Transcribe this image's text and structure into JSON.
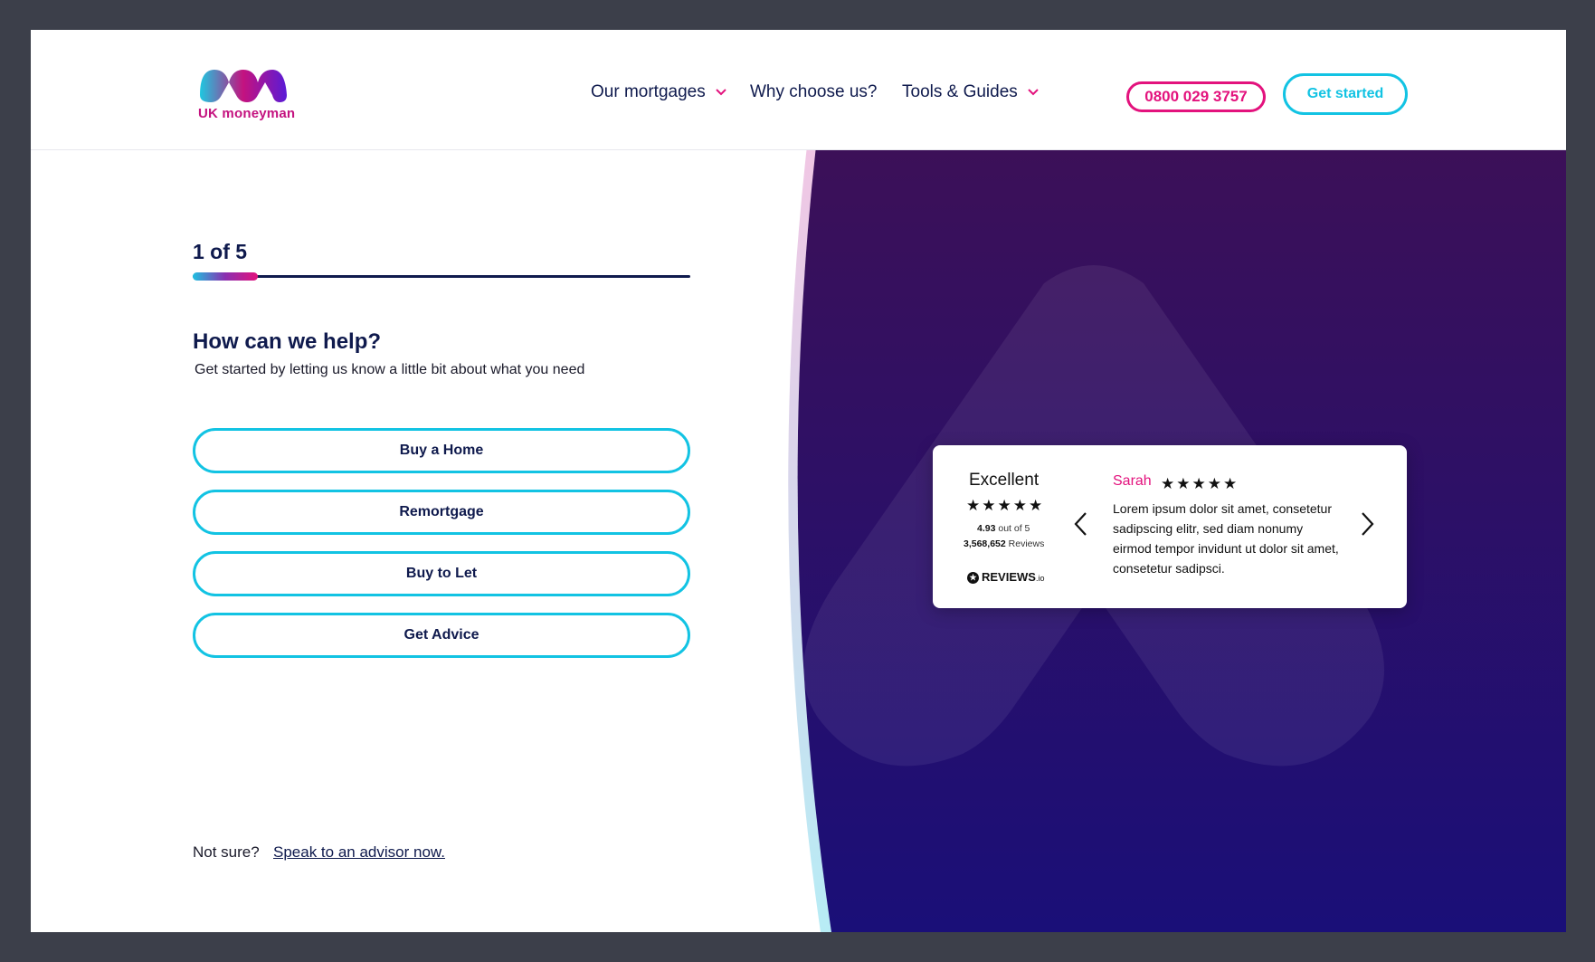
{
  "header": {
    "logo_text": "UK moneyman",
    "nav": [
      {
        "label": "Our mortgages",
        "has_dropdown": true
      },
      {
        "label": "Why choose us?",
        "has_dropdown": false
      },
      {
        "label": "Tools & Guides",
        "has_dropdown": true
      }
    ],
    "phone_label": "0800 029 3757",
    "cta_label": "Get started"
  },
  "progress": {
    "step_label": "1 of 5",
    "fraction": 0.13
  },
  "form": {
    "heading": "How can we help?",
    "subtitle": "Get started by letting us know a little bit about what you need",
    "options": [
      "Buy a Home",
      "Remortgage",
      "Buy to Let",
      "Get Advice"
    ]
  },
  "footer": {
    "not_sure": "Not sure?",
    "advisor_link": "Speak to an advisor now."
  },
  "review_widget": {
    "rating_label": "Excellent",
    "rating_stars": 5,
    "score": "4.93",
    "score_suffix": "out of 5",
    "count": "3,568,652",
    "count_suffix": "Reviews",
    "provider": "REVIEWS",
    "provider_suffix": ".io",
    "reviewer": "Sarah",
    "review_stars": 5,
    "review_text": "Lorem ipsum dolor sit amet, consetetur sadipscing elitr, sed diam nonumy eirmod tempor invidunt ut dolor sit amet, consetetur sadipsci."
  },
  "colors": {
    "navy": "#0f1a4d",
    "magenta": "#e3127d",
    "cyan": "#12c3e3",
    "purple_top": "#3c1058",
    "purple_bottom": "#1a0f78"
  },
  "icons": [
    "chevron-down-icon",
    "chevron-left-icon",
    "chevron-right-icon",
    "star-icon",
    "reviews-logo-icon",
    "moneyman-logo-icon",
    "brand-watermark-icon"
  ]
}
